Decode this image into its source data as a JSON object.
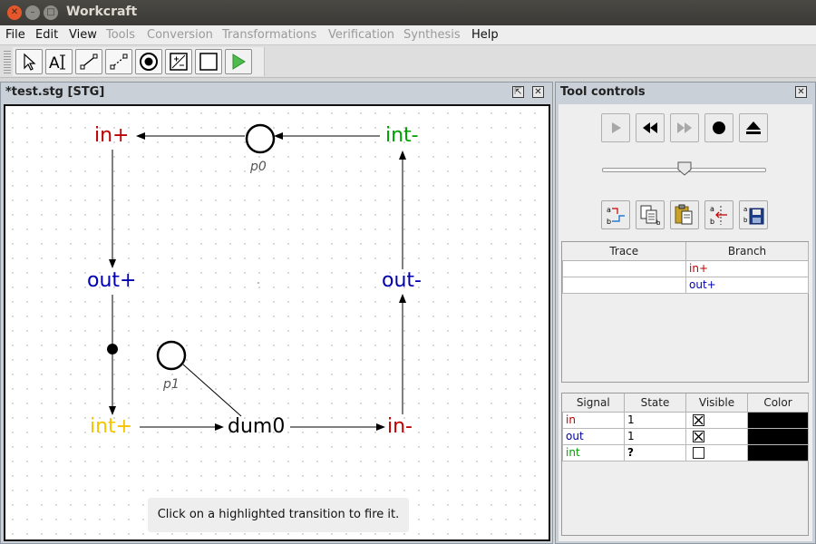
{
  "window": {
    "title": "Workcraft"
  },
  "menu": [
    "File",
    "Edit",
    "View",
    "Tools",
    "Conversion",
    "Transformations",
    "Verification",
    "Synthesis",
    "Help"
  ],
  "menu_disabled": [
    "Tools",
    "Conversion",
    "Transformations",
    "Verification",
    "Synthesis"
  ],
  "toolbar": {
    "tools": [
      "select-tool",
      "text-tool",
      "connect-tool",
      "read-arc-tool",
      "place-tool",
      "transition-tool",
      "generic-tool",
      "simulation-tool"
    ],
    "active": "simulation-tool"
  },
  "editor": {
    "tab_title": "*test.stg [STG]",
    "nodes": [
      {
        "id": "in_plus",
        "label": "in+",
        "color": "#c00000"
      },
      {
        "id": "int_minus",
        "label": "int-",
        "color": "#00a000"
      },
      {
        "id": "out_plus",
        "label": "out+",
        "color": "#0000b0"
      },
      {
        "id": "out_minus",
        "label": "out-",
        "color": "#0000b0"
      },
      {
        "id": "int_plus",
        "label": "int+",
        "color": "#f5c400"
      },
      {
        "id": "dum0",
        "label": "dum0",
        "color": "#000000"
      },
      {
        "id": "in_minus",
        "label": "in-",
        "color": "#c00000"
      }
    ],
    "places": [
      {
        "id": "p0",
        "label": "p0",
        "tokens": 0
      },
      {
        "id": "p1",
        "label": "p1",
        "tokens": 0
      }
    ],
    "marked_implicit_place_tokens": 1,
    "hint": "Click on a highlighted transition to fire it."
  },
  "tool_controls": {
    "title": "Tool controls",
    "sim_buttons": [
      "play-icon",
      "rewind-icon",
      "fast-forward-icon",
      "record-icon",
      "eject-icon"
    ],
    "speed_level": 0.5,
    "trace_buttons": [
      "trace-to-graph-icon",
      "copy-trace-icon",
      "paste-trace-icon",
      "merge-trace-icon",
      "save-trace-icon"
    ],
    "trace_table": {
      "headers": [
        "Trace",
        "Branch"
      ],
      "rows": [
        {
          "trace": "",
          "branch": "in+",
          "branch_color": "#c00000"
        },
        {
          "trace": "",
          "branch": "out+",
          "branch_color": "#0000b0"
        }
      ]
    },
    "signal_table": {
      "headers": [
        "Signal",
        "State",
        "Visible",
        "Color"
      ],
      "rows": [
        {
          "signal": "in",
          "signal_color": "#c00000",
          "state": "1",
          "visible": true,
          "color": "#000000"
        },
        {
          "signal": "out",
          "signal_color": "#0000b0",
          "state": "1",
          "visible": true,
          "color": "#000000"
        },
        {
          "signal": "int",
          "signal_color": "#00a000",
          "state": "?",
          "visible": false,
          "color": "#000000"
        }
      ]
    }
  }
}
